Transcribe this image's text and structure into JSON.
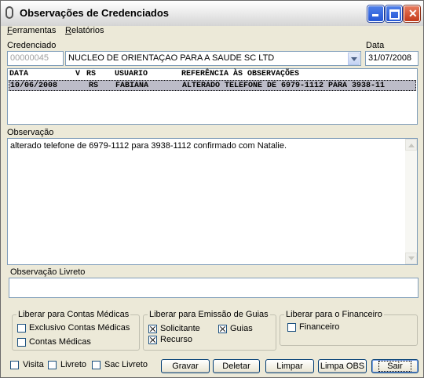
{
  "window": {
    "title": "Observações de Credenciados"
  },
  "menu": {
    "items": [
      {
        "label": "Ferramentas",
        "accel": "F",
        "rest": "erramentas"
      },
      {
        "label": "Relatórios",
        "accel": "R",
        "rest": "elatórios"
      }
    ]
  },
  "credenciado": {
    "label": "Credenciado",
    "code": "00000045",
    "name": "NUCLEO DE ORIENTAÇAO PARA A SAUDE SC LTD"
  },
  "data": {
    "label": "Data",
    "value": "31/07/2008"
  },
  "grid": {
    "columns": [
      "DATA",
      "V",
      "RS",
      "USUARIO",
      "REFERÊNCIA ÀS OBSERVAÇÕES"
    ],
    "rows": [
      {
        "data": "10/06/2008",
        "v": "",
        "rs": "RS",
        "usuario": "FABIANA",
        "referencia": "ALTERADO TELEFONE DE 6979-1112 PARA 3938-11"
      }
    ]
  },
  "observacao": {
    "label": "Observação",
    "text": "alterado telefone de 6979-1112 para 3938-1112 confirmado com Natalie."
  },
  "observacao_livreto": {
    "label": "Observação Livreto",
    "text": ""
  },
  "groups": {
    "contas": {
      "title": "Liberar para Contas Médicas",
      "items": [
        {
          "label": "Exclusivo Contas Médicas",
          "checked": false
        },
        {
          "label": "Contas Médicas",
          "checked": false
        }
      ]
    },
    "guias": {
      "title": "Liberar para Emissão de Guias",
      "items": [
        {
          "label": "Solicitante",
          "checked": true
        },
        {
          "label": "Guias",
          "checked": true
        },
        {
          "label": "Recurso",
          "checked": true
        }
      ]
    },
    "financeiro": {
      "title": "Liberar para o Financeiro",
      "items": [
        {
          "label": "Financeiro",
          "checked": false
        }
      ]
    }
  },
  "bottom_checks": [
    {
      "label": "Visita",
      "checked": false
    },
    {
      "label": "Livreto",
      "checked": false
    },
    {
      "label": "Sac Livreto",
      "checked": false
    }
  ],
  "buttons": {
    "gravar": "Gravar",
    "deletar": "Deletar",
    "limpar": "Limpar",
    "limpa_obs": "Limpa OBS",
    "sair": "Sair"
  }
}
